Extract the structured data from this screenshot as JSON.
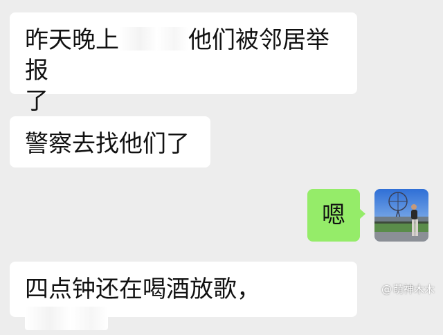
{
  "messages": [
    {
      "side": "left",
      "line1_pre": "昨天晚上",
      "line1_post": "他们被邻居举报",
      "line2": "了"
    },
    {
      "side": "left",
      "text": "警察去找他们了"
    },
    {
      "side": "right",
      "text": "嗯"
    },
    {
      "side": "left",
      "text": "四点钟还在喝酒放歌，"
    }
  ],
  "watermark": {
    "prefix": "@",
    "handle": "萌神木木"
  },
  "colors": {
    "background": "#ededed",
    "incoming_bubble": "#ffffff",
    "outgoing_bubble": "#95ec69"
  },
  "avatar": {
    "icon": "user-photo-avatar"
  }
}
